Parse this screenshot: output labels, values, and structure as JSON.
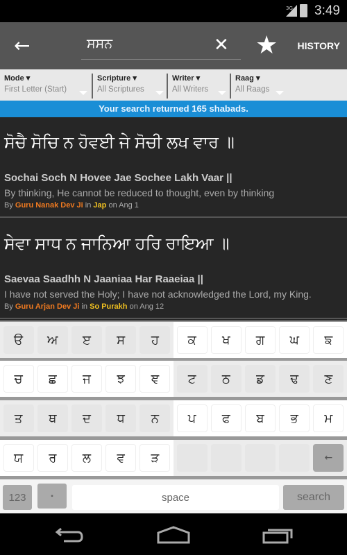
{
  "status": {
    "time": "3:49",
    "network": "3G",
    "icons": [
      "signal-icon",
      "battery-charging-icon"
    ]
  },
  "toolbar": {
    "back_icon": "arrow-left-icon",
    "query": "ਸਸਨ",
    "clear_icon": "close-icon",
    "star_icon": "star-icon",
    "history_label": "HISTORY"
  },
  "filters": [
    {
      "label": "Mode ▾",
      "value": "First Letter (Start)"
    },
    {
      "label": "Scripture ▾",
      "value": "All Scriptures"
    },
    {
      "label": "Writer ▾",
      "value": "All Writers"
    },
    {
      "label": "Raag ▾",
      "value": "All Raags"
    }
  ],
  "banner": "Your search returned 165 shabads.",
  "results": [
    {
      "gurmukhi": "ਸੋਚੈ ਸੋਚਿ ਨ ਹੋਵਈ ਜੇ ਸੋਚੀ ਲਖ ਵਾਰ ॥",
      "roman": "Sochai Soch N Hovee Jae Sochee Lakh Vaar ||",
      "translation": "By thinking, He cannot be reduced to thought, even by thinking",
      "by": "By ",
      "writer": "Guru Nanak Dev Ji",
      "in": " in ",
      "source": "Jap",
      "on": " on Ang 1"
    },
    {
      "gurmukhi": "ਸੇਵਾ ਸਾਧ ਨ ਜਾਨਿਆ ਹਰਿ ਰਾਇਆ ॥",
      "roman": "Saevaa Saadhh N Jaaniaa Har Raaeiaa ||",
      "translation": "I have not served the Holy; I have not acknowledged the Lord, my King.",
      "by": "By ",
      "writer": "Guru Arjan Dev Ji",
      "in": " in ",
      "source": "So Purakh",
      "on": " on Ang 12"
    }
  ],
  "keyboard": {
    "rows": [
      [
        "ੳ",
        "ਅ",
        "ੲ",
        "ਸ",
        "ਹ",
        "ਕ",
        "ਖ",
        "ਗ",
        "ਘ",
        "ਙ"
      ],
      [
        "ਚ",
        "ਛ",
        "ਜ",
        "ਝ",
        "ਞ",
        "ਟ",
        "ਠ",
        "ਡ",
        "ਢ",
        "ਣ"
      ],
      [
        "ਤ",
        "ਥ",
        "ਦ",
        "ਧ",
        "ਨ",
        "ਪ",
        "ਫ",
        "ਬ",
        "ਭ",
        "ਮ"
      ],
      [
        "ਯ",
        "ਰ",
        "ਲ",
        "ਵ",
        "ੜ",
        "",
        "",
        "",
        "",
        "←"
      ]
    ],
    "numbers": "123",
    "dot": "▪",
    "space": "space",
    "search": "search"
  },
  "colors": {
    "accent": "#1a8ed6",
    "writer": "#f07a20",
    "source": "#f0c020"
  },
  "nav_icons": [
    "back-icon",
    "home-icon",
    "recent-apps-icon"
  ]
}
